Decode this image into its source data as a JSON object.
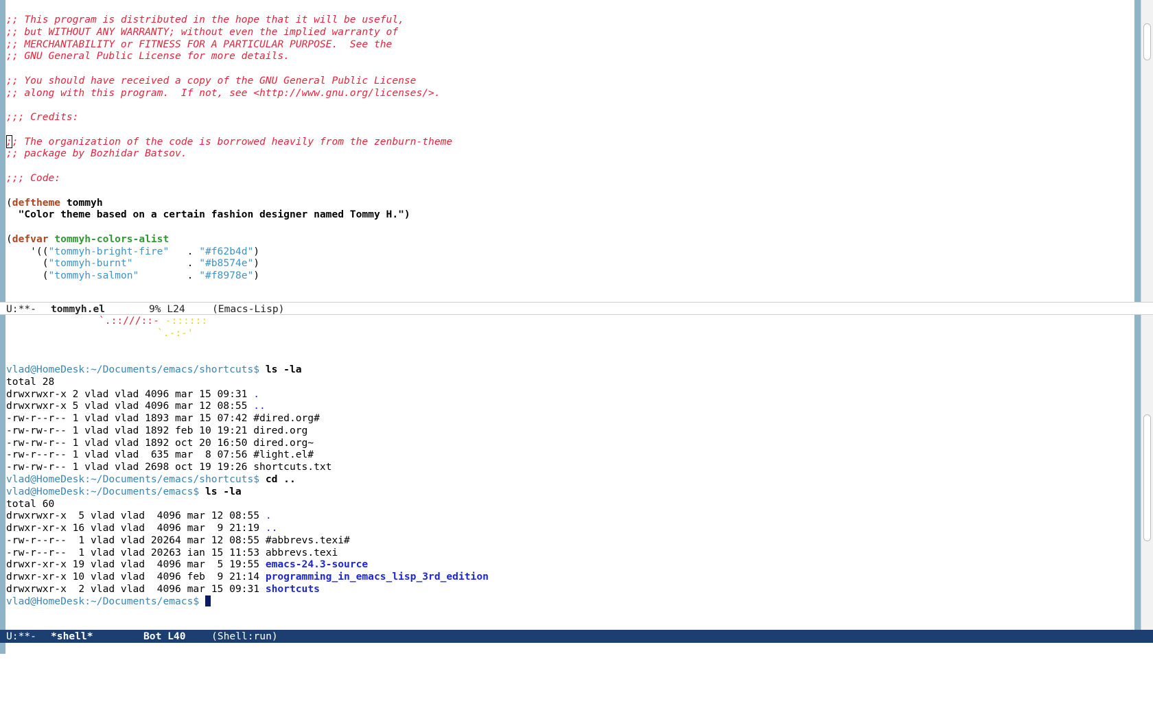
{
  "top_window": {
    "lines": [
      {
        "text": ";; This program is distributed in the hope that it will be useful,",
        "kind": "comment"
      },
      {
        "text": ";; but WITHOUT ANY WARRANTY; without even the implied warranty of",
        "kind": "comment"
      },
      {
        "text": ";; MERCHANTABILITY or FITNESS FOR A PARTICULAR PURPOSE.  See the",
        "kind": "comment"
      },
      {
        "text": ";; GNU General Public License for more details.",
        "kind": "comment"
      },
      {
        "text": "",
        "kind": "blank"
      },
      {
        "text": ";; You should have received a copy of the GNU General Public License",
        "kind": "comment"
      },
      {
        "text": ";; along with this program.  If not, see <http://www.gnu.org/licenses/>.",
        "kind": "comment"
      },
      {
        "text": "",
        "kind": "blank"
      },
      {
        "text": ";;; Credits:",
        "kind": "comment"
      },
      {
        "text": "",
        "kind": "blank"
      },
      {
        "text_cursor": ";",
        "text": "; The organization of the code is borrowed heavily from the zenburn-theme",
        "kind": "comment-cursor"
      },
      {
        "text": ";; package by Bozhidar Batsov.",
        "kind": "comment"
      },
      {
        "text": "",
        "kind": "blank"
      },
      {
        "text": ";;; Code:",
        "kind": "comment"
      },
      {
        "text": "",
        "kind": "blank"
      },
      {
        "open": "(",
        "keyword": "deftheme",
        "name": "tommyh",
        "kind": "deftheme"
      },
      {
        "text": "  \"Color theme based on a certain fashion designer named Tommy H.\")",
        "kind": "bold"
      },
      {
        "text": "",
        "kind": "blank"
      },
      {
        "open": "(",
        "keyword": "defvar",
        "name": "tommyh-colors-alist",
        "kind": "defvar"
      },
      {
        "prefix": "    '((",
        "string": "\"tommyh-bright-fire\"",
        "dot": "   . ",
        "value": "\"#f62b4d\"",
        "close": ")",
        "kind": "pair"
      },
      {
        "prefix": "      (",
        "string": "\"tommyh-burnt\"",
        "dot": "         . ",
        "value": "\"#b8574e\"",
        "close": ")",
        "kind": "pair"
      },
      {
        "prefix": "      (",
        "string": "\"tommyh-salmon\"",
        "dot": "        . ",
        "value": "\"#f8978e\"",
        "close": ")",
        "kind": "pair"
      }
    ]
  },
  "top_modeline": {
    "status": "U:**-",
    "buffer": "tommyh.el",
    "position": "9% L24",
    "mode": "(Emacs-Lisp)"
  },
  "bottom_window": {
    "art": [
      {
        "red": "`.::///::- ",
        "yellow": "-::::::"
      },
      {
        "red": "",
        "yellow": "`.-:-'"
      }
    ],
    "session": [
      {
        "kind": "blank"
      },
      {
        "kind": "blank"
      },
      {
        "kind": "prompt",
        "prompt": "vlad@HomeDesk:~/Documents/emacs/shortcuts$ ",
        "cmd": "ls -la"
      },
      {
        "kind": "plain",
        "text": "total 28"
      },
      {
        "kind": "entry",
        "meta": "drwxrwxr-x 2 vlad vlad 4096 mar 15 09:31 ",
        "name": ".",
        "style": "dot"
      },
      {
        "kind": "entry",
        "meta": "drwxrwxr-x 5 vlad vlad 4096 mar 12 08:55 ",
        "name": "..",
        "style": "dot"
      },
      {
        "kind": "entry",
        "meta": "-rw-r--r-- 1 vlad vlad 1893 mar 15 07:42 ",
        "name": "#dired.org#",
        "style": "plain"
      },
      {
        "kind": "entry",
        "meta": "-rw-rw-r-- 1 vlad vlad 1892 feb 10 19:21 ",
        "name": "dired.org",
        "style": "plain"
      },
      {
        "kind": "entry",
        "meta": "-rw-rw-r-- 1 vlad vlad 1892 oct 20 16:50 ",
        "name": "dired.org~",
        "style": "plain"
      },
      {
        "kind": "entry",
        "meta": "-rw-r--r-- 1 vlad vlad  635 mar  8 07:56 ",
        "name": "#light.el#",
        "style": "plain"
      },
      {
        "kind": "entry",
        "meta": "-rw-rw-r-- 1 vlad vlad 2698 oct 19 19:26 ",
        "name": "shortcuts.txt",
        "style": "plain"
      },
      {
        "kind": "prompt",
        "prompt": "vlad@HomeDesk:~/Documents/emacs/shortcuts$ ",
        "cmd": "cd .."
      },
      {
        "kind": "prompt",
        "prompt": "vlad@HomeDesk:~/Documents/emacs$ ",
        "cmd": "ls -la"
      },
      {
        "kind": "plain",
        "text": "total 60"
      },
      {
        "kind": "entry",
        "meta": "drwxrwxr-x  5 vlad vlad  4096 mar 12 08:55 ",
        "name": ".",
        "style": "dot"
      },
      {
        "kind": "entry",
        "meta": "drwxr-xr-x 16 vlad vlad  4096 mar  9 21:19 ",
        "name": "..",
        "style": "dot"
      },
      {
        "kind": "entry",
        "meta": "-rw-r--r--  1 vlad vlad 20264 mar 12 08:55 ",
        "name": "#abbrevs.texi#",
        "style": "plain"
      },
      {
        "kind": "entry",
        "meta": "-rw-r--r--  1 vlad vlad 20263 ian 15 11:53 ",
        "name": "abbrevs.texi",
        "style": "plain"
      },
      {
        "kind": "entry",
        "meta": "drwxr-xr-x 19 vlad vlad  4096 mar  5 19:55 ",
        "name": "emacs-24.3-source",
        "style": "dir"
      },
      {
        "kind": "entry",
        "meta": "drwxr-xr-x 10 vlad vlad  4096 feb  9 21:14 ",
        "name": "programming_in_emacs_lisp_3rd_edition",
        "style": "dir"
      },
      {
        "kind": "entry",
        "meta": "drwxrwxr-x  2 vlad vlad  4096 mar 15 09:31 ",
        "name": "shortcuts",
        "style": "dir"
      },
      {
        "kind": "prompt-cursor",
        "prompt": "vlad@HomeDesk:~/Documents/emacs$ ",
        "cmd": ""
      }
    ]
  },
  "bottom_modeline": {
    "status": "U:**-",
    "buffer": "*shell*",
    "position": "Bot L40",
    "mode": "(Shell:run)"
  },
  "colors": {
    "comment": "#e8233c",
    "keyword": "#b3441f",
    "function_name": "#2f9a2f",
    "string": "#3e93c7",
    "prompt": "#3a86b5",
    "directory": "#1b26d6",
    "active_modeline": "#1c3f72",
    "fringe": "#8fb3c7"
  }
}
